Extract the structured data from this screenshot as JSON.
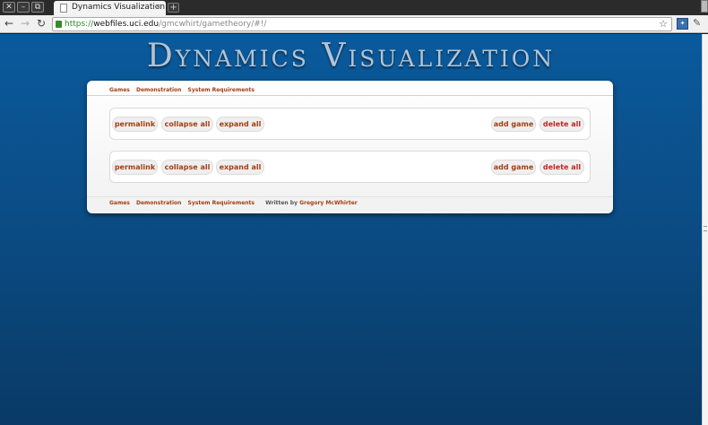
{
  "browser": {
    "window_controls": [
      "✕",
      "–",
      "⧉"
    ],
    "tab_title": "Dynamics Visualization",
    "tab_close": "×",
    "new_tab": "+",
    "url_scheme": "https://",
    "url_host": "webfiles.uci.edu",
    "url_path": "/gmcwhirt/gametheory/#!/",
    "icons": [
      "page-icon",
      "back-icon",
      "forward-icon",
      "reload-icon",
      "lock-icon",
      "star-icon",
      "extension-icon",
      "wrench-icon"
    ]
  },
  "page": {
    "title": "Dynamics Visualization",
    "nav": [
      "Games",
      "Demonstration",
      "System Requirements"
    ],
    "footer_nav": [
      "Games",
      "Demonstration",
      "System Requirements"
    ],
    "credit_prefix": "Written by",
    "credit_author": "Gregory McWhirter",
    "games": [
      {
        "permalink": "permalink",
        "collapse": "collapse all",
        "expand": "expand all",
        "add": "add game",
        "delete": "delete all"
      },
      {
        "permalink": "permalink",
        "collapse": "collapse all",
        "expand": "expand all",
        "add": "add game",
        "delete": "delete all"
      }
    ]
  },
  "colors": {
    "background_top": "#0a5a9c",
    "background_bottom": "#0a3a66",
    "link": "#a33f12",
    "delete": "#c0261e",
    "title": "#b4c3d3"
  }
}
